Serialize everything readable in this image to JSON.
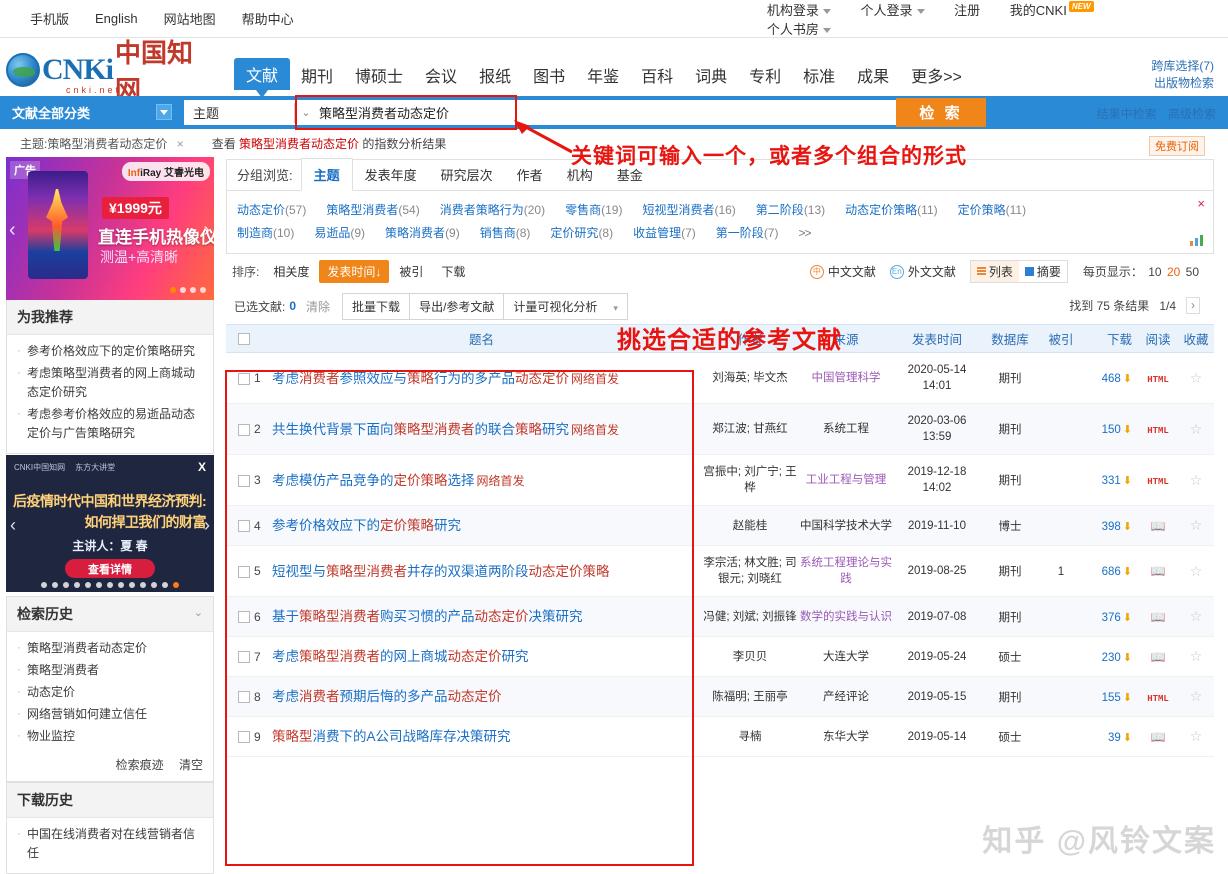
{
  "topbar": {
    "left_links": [
      "手机版",
      "English",
      "网站地图",
      "帮助中心"
    ],
    "right_links": [
      "机构登录",
      "个人登录",
      "注册",
      "我的CNKI",
      "个人书房"
    ],
    "new_badge": "NEW"
  },
  "logo": {
    "wordmark": "CNKi",
    "cn": "中国知网",
    "domain": "cnki.net"
  },
  "nav": {
    "items": [
      "文献",
      "期刊",
      "博硕士",
      "会议",
      "报纸",
      "图书",
      "年鉴",
      "百科",
      "词典",
      "专利",
      "标准",
      "成果",
      "更多>>"
    ],
    "active": "文献",
    "side_links": [
      "跨库选择(7)",
      "出版物检索"
    ],
    "side_links2": [
      "结果中检索",
      "高级检索"
    ]
  },
  "search": {
    "category": "文献全部分类",
    "field_type": "主题",
    "query": "策略型消费者动态定价",
    "placeholder": "",
    "button": "检 索"
  },
  "chiprow": {
    "chip": "主题:策略型消费者动态定价",
    "chip_close": "×",
    "index_prefix": "查看 ",
    "index_keyword": "策略型消费者动态定价",
    "index_suffix": " 的指数分析结果"
  },
  "ad": {
    "tag": "广告",
    "brand_prefix": "Inf",
    "brand": "iRay 艾睿光电",
    "price": "¥1999元",
    "line1": "直连手机热像仪",
    "line2": "测温+高清晰"
  },
  "recommend": {
    "title": "为我推荐",
    "items": [
      "参考价格效应下的定价策略研究",
      "考虑策略型消费者的网上商城动态定价研究",
      "考虑参考价格效应的易逝品动态定价与广告策略研究"
    ]
  },
  "promo": {
    "close": "X",
    "logo1": "CNKI中国知网",
    "logo2": "东方大讲堂",
    "title1": "后疫情时代中国和世界经济预判:",
    "title2": "如何捍卫我们的财富",
    "speaker": "主讲人：夏 春",
    "button": "查看详情"
  },
  "history": {
    "title": "检索历史",
    "items": [
      "策略型消费者动态定价",
      "策略型消费者",
      "动态定价",
      "网络营销如何建立信任",
      "物业监控"
    ],
    "actions": [
      "检索痕迹",
      "清空"
    ]
  },
  "download_history": {
    "title": "下载历史",
    "items": [
      "中国在线消费者对在线营销者信任"
    ]
  },
  "group": {
    "label": "分组浏览:",
    "tabs": [
      "主题",
      "发表年度",
      "研究层次",
      "作者",
      "机构",
      "基金"
    ],
    "active_tab": "主题",
    "subscribe": "免费订阅",
    "close": "×",
    "keywords": [
      {
        "name": "动态定价",
        "count": "(57)"
      },
      {
        "name": "策略型消费者",
        "count": "(54)"
      },
      {
        "name": "消费者策略行为",
        "count": "(20)"
      },
      {
        "name": "零售商",
        "count": "(19)"
      },
      {
        "name": "短视型消费者",
        "count": "(16)"
      },
      {
        "name": "第二阶段",
        "count": "(13)"
      },
      {
        "name": "动态定价策略",
        "count": "(11)"
      },
      {
        "name": "定价策略",
        "count": "(11)"
      },
      {
        "name": "制造商",
        "count": "(10)"
      },
      {
        "name": "易逝品",
        "count": "(9)"
      },
      {
        "name": "策略消费者",
        "count": "(9)"
      },
      {
        "name": "销售商",
        "count": "(8)"
      },
      {
        "name": "定价研究",
        "count": "(8)"
      },
      {
        "name": "收益管理",
        "count": "(7)"
      },
      {
        "name": "第一阶段",
        "count": "(7)"
      }
    ],
    "more": ">>"
  },
  "sort": {
    "label": "排序:",
    "options": [
      "相关度",
      "发表时间↓",
      "被引",
      "下载"
    ],
    "active": "发表时间↓",
    "cn_lit": "中文文献",
    "en_lit": "外文文献",
    "cn_icon": "中",
    "en_icon": "En",
    "list_view": "列表",
    "abstract_view": "摘要",
    "perpage_label": "每页显示：",
    "perpage_options": [
      "10",
      "20",
      "50"
    ],
    "perpage_active": "20"
  },
  "actions": {
    "selected_label": "已选文献:",
    "selected_count": "0",
    "clear": "清除",
    "buttons": [
      "批量下载",
      "导出/参考文献",
      "计量可视化分析"
    ],
    "found": "找到 75 条结果",
    "page": "1/4",
    "next": "›"
  },
  "table": {
    "headers": [
      "",
      "题名",
      "作者",
      "来源",
      "发表时间",
      "数据库",
      "被引",
      "下载",
      "阅读",
      "收藏"
    ],
    "rows": [
      {
        "index": "1",
        "title_parts": [
          {
            "t": "考虑",
            "hl": false
          },
          {
            "t": "消费者",
            "hl": true
          },
          {
            "t": "参照效应与",
            "hl": false
          },
          {
            "t": "策略",
            "hl": true
          },
          {
            "t": "行为的多产品",
            "hl": false
          },
          {
            "t": "动态定价",
            "hl": true
          }
        ],
        "newpub": "网络首发",
        "authors": "刘海英; 毕文杰",
        "source": "中国管理科学",
        "source_link": true,
        "date": "2020-05-14\n14:01",
        "db": "期刊",
        "cite": "",
        "download": "468",
        "read_type": "html",
        "fav": "☆"
      },
      {
        "index": "2",
        "title_parts": [
          {
            "t": "共生换代背景下面向",
            "hl": false
          },
          {
            "t": "策略型消费者",
            "hl": true
          },
          {
            "t": "的联合",
            "hl": false
          },
          {
            "t": "策略",
            "hl": true
          },
          {
            "t": "研究",
            "hl": false
          }
        ],
        "newpub": "网络首发",
        "authors": "郑江波; 甘燕红",
        "source": "系统工程",
        "source_link": false,
        "date": "2020-03-06\n13:59",
        "db": "期刊",
        "cite": "",
        "download": "150",
        "read_type": "html",
        "fav": "☆"
      },
      {
        "index": "3",
        "title_parts": [
          {
            "t": "考虑模仿产品竞争的",
            "hl": false
          },
          {
            "t": "定价策略",
            "hl": true
          },
          {
            "t": "选择",
            "hl": false
          }
        ],
        "newpub": "网络首发",
        "authors": "宫振中; 刘广宁; 王桦",
        "source": "工业工程与管理",
        "source_link": true,
        "date": "2019-12-18\n14:02",
        "db": "期刊",
        "cite": "",
        "download": "331",
        "read_type": "html",
        "fav": "☆"
      },
      {
        "index": "4",
        "title_parts": [
          {
            "t": "参考价格效应下的",
            "hl": false
          },
          {
            "t": "定价策略",
            "hl": true
          },
          {
            "t": "研究",
            "hl": false
          }
        ],
        "newpub": "",
        "authors": "赵能桂",
        "source": "中国科学技术大学",
        "source_link": false,
        "date": "2019-11-10",
        "db": "博士",
        "cite": "",
        "download": "398",
        "read_type": "book",
        "fav": "☆"
      },
      {
        "index": "5",
        "title_parts": [
          {
            "t": "短视型与",
            "hl": false
          },
          {
            "t": "策略型消费者",
            "hl": true
          },
          {
            "t": "并存的双渠道两阶段",
            "hl": false
          },
          {
            "t": "动态定价策略",
            "hl": true
          }
        ],
        "newpub": "",
        "authors": "李宗活; 林文胜; 司银元; 刘晓红",
        "source": "系统工程理论与实践",
        "source_link": true,
        "date": "2019-08-25",
        "db": "期刊",
        "cite": "1",
        "download": "686",
        "read_type": "book",
        "fav": "☆"
      },
      {
        "index": "6",
        "title_parts": [
          {
            "t": "基于",
            "hl": false
          },
          {
            "t": "策略型消费者",
            "hl": true
          },
          {
            "t": "购买习惯的产品",
            "hl": false
          },
          {
            "t": "动态定价",
            "hl": true
          },
          {
            "t": "决策研究",
            "hl": false
          }
        ],
        "newpub": "",
        "authors": "冯健; 刘斌; 刘振锋",
        "source": "数学的实践与认识",
        "source_link": true,
        "date": "2019-07-08",
        "db": "期刊",
        "cite": "",
        "download": "376",
        "read_type": "book",
        "fav": "☆"
      },
      {
        "index": "7",
        "title_parts": [
          {
            "t": "考虑",
            "hl": false
          },
          {
            "t": "策略型消费者",
            "hl": true
          },
          {
            "t": "的网上商城",
            "hl": false
          },
          {
            "t": "动态定价",
            "hl": true
          },
          {
            "t": "研究",
            "hl": false
          }
        ],
        "newpub": "",
        "authors": "李贝贝",
        "source": "大连大学",
        "source_link": false,
        "date": "2019-05-24",
        "db": "硕士",
        "cite": "",
        "download": "230",
        "read_type": "book",
        "fav": "☆"
      },
      {
        "index": "8",
        "title_parts": [
          {
            "t": "考虑",
            "hl": false
          },
          {
            "t": "消费者",
            "hl": true
          },
          {
            "t": "预期后悔的多产品",
            "hl": false
          },
          {
            "t": "动态定价",
            "hl": true
          }
        ],
        "newpub": "",
        "authors": "陈福明; 王丽亭",
        "source": "产经评论",
        "source_link": false,
        "date": "2019-05-15",
        "db": "期刊",
        "cite": "",
        "download": "155",
        "read_type": "html",
        "fav": "☆"
      },
      {
        "index": "9",
        "title_parts": [
          {
            "t": "策略型",
            "hl": true
          },
          {
            "t": "消费下的A公司战略库存决策研究",
            "hl": false
          }
        ],
        "newpub": "",
        "authors": "寻楠",
        "source": "东华大学",
        "source_link": false,
        "date": "2019-05-14",
        "db": "硕士",
        "cite": "",
        "download": "39",
        "read_type": "book",
        "fav": "☆"
      }
    ]
  },
  "annotations": {
    "note1": "关键词可输入一个，或者多个组合的形式",
    "note2": "挑选合适的参考文献"
  },
  "watermark": "知乎 @风铃文案",
  "colors": {
    "brand_blue": "#2b8ad6",
    "accent_orange": "#f08519",
    "link_blue": "#1a6fc4",
    "highlight_red": "#c0392b",
    "annotation_red": "#e8140f"
  }
}
